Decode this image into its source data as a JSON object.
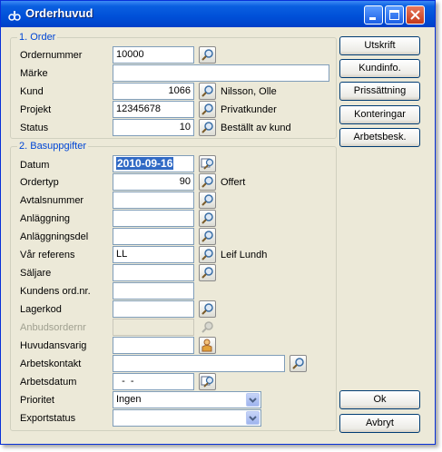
{
  "window": {
    "title": "Orderhuvud"
  },
  "group1": {
    "legend": "1. Order",
    "rows": [
      {
        "label": "Ordernummer",
        "value": "10000",
        "desc": ""
      },
      {
        "label": "Märke",
        "value": "",
        "desc": ""
      },
      {
        "label": "Kund",
        "value": "1066",
        "desc": "Nilsson, Olle"
      },
      {
        "label": "Projekt",
        "value": "12345678",
        "desc": "Privatkunder"
      },
      {
        "label": "Status",
        "value": "10",
        "desc": "Beställt av kund"
      }
    ]
  },
  "group2": {
    "legend": "2. Basuppgifter",
    "rows": [
      {
        "label": "Datum",
        "value": "2010-09-16",
        "desc": ""
      },
      {
        "label": "Ordertyp",
        "value": "90",
        "desc": "Offert"
      },
      {
        "label": "Avtalsnummer",
        "value": "",
        "desc": ""
      },
      {
        "label": "Anläggning",
        "value": "",
        "desc": ""
      },
      {
        "label": "Anläggningsdel",
        "value": "",
        "desc": ""
      },
      {
        "label": "Vår referens",
        "value": "LL",
        "desc": "Leif Lundh"
      },
      {
        "label": "Säljare",
        "value": "",
        "desc": ""
      },
      {
        "label": "Kundens ord.nr.",
        "value": "",
        "desc": ""
      },
      {
        "label": "Lagerkod",
        "value": "",
        "desc": ""
      },
      {
        "label": "Anbudsordernr",
        "value": "",
        "desc": ""
      },
      {
        "label": "Huvudansvarig",
        "value": "",
        "desc": ""
      },
      {
        "label": "Arbetskontakt",
        "value": "",
        "desc": ""
      },
      {
        "label": "Arbetsdatum",
        "value": "  -  -",
        "desc": ""
      },
      {
        "label": "Prioritet",
        "value": "Ingen",
        "desc": ""
      },
      {
        "label": "Exportstatus",
        "value": "",
        "desc": ""
      }
    ]
  },
  "buttons": {
    "utskrift": "Utskrift",
    "kundinfo": "Kundinfo.",
    "prissattning": "Prissättning",
    "konteringar": "Konteringar",
    "arbetsbesk": "Arbetsbesk.",
    "ok": "Ok",
    "avbryt": "Avbryt"
  },
  "icons": {
    "lookup": "magnifier-icon",
    "calendar_lookup": "calendar-magnifier-icon",
    "person_lookup": "person-icon",
    "dropdown": "chevron-down-icon"
  }
}
